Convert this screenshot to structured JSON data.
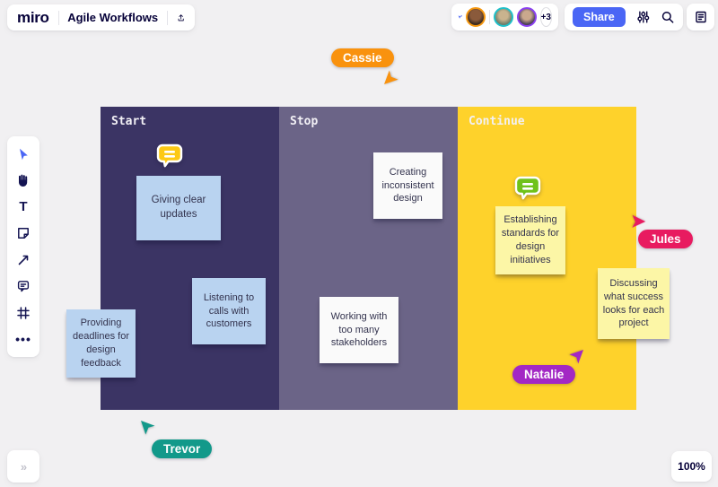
{
  "topbar": {
    "logo": "miro",
    "board_title": "Agile Workflows",
    "share_label": "Share",
    "collaborators_overflow": "+3"
  },
  "toolbar": {
    "items": [
      "select",
      "hand",
      "text",
      "sticky-note",
      "arrow",
      "comment",
      "frame",
      "more"
    ]
  },
  "board": {
    "columns": [
      {
        "label": "Start",
        "color": "#3b3464"
      },
      {
        "label": "Stop",
        "color": "#6b6487"
      },
      {
        "label": "Continue",
        "color": "#fed22b"
      }
    ],
    "notes": [
      {
        "text": "Giving clear updates",
        "color": "#b9d3f0"
      },
      {
        "text": "Providing deadlines for design feedback",
        "color": "#b9d3f0"
      },
      {
        "text": "Listening to calls with customers",
        "color": "#b9d3f0"
      },
      {
        "text": "Creating inconsistent design",
        "color": "#fafafa"
      },
      {
        "text": "Working with too many stakeholders",
        "color": "#fafafa"
      },
      {
        "text": "Establishing standards for design initiatives",
        "color": "#fcf6a6"
      },
      {
        "text": "Discussing what success looks for each project",
        "color": "#fcf6a6"
      }
    ],
    "comment_markers": [
      {
        "color": "#fdc915"
      },
      {
        "color": "#6fc21b"
      }
    ]
  },
  "cursors": [
    {
      "name": "Cassie",
      "color": "#f9920e"
    },
    {
      "name": "Jules",
      "color": "#e81b60"
    },
    {
      "name": "Natalie",
      "color": "#a328c4"
    },
    {
      "name": "Trevor",
      "color": "#12998a"
    }
  ],
  "zoom_badge": "100%",
  "colors": {
    "accent_blue": "#4a66f5",
    "ink": "#050038",
    "canvas": "#f1f0f2"
  }
}
